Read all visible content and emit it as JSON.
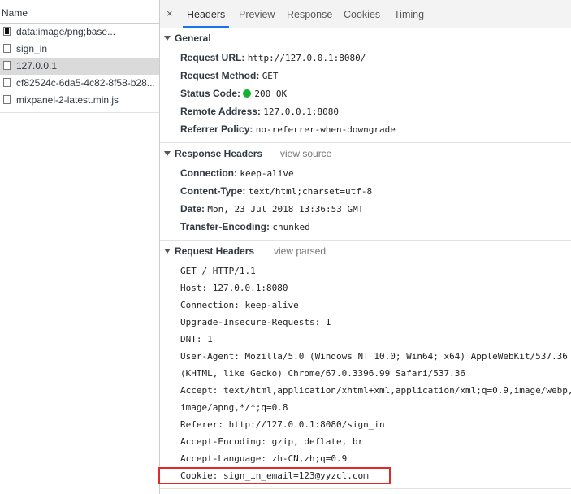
{
  "left_panel": {
    "header": "Name",
    "files": [
      {
        "name": "data:image/png;base...",
        "icon": "image-file-icon"
      },
      {
        "name": "sign_in",
        "icon": "document-icon"
      },
      {
        "name": "127.0.0.1",
        "icon": "document-icon",
        "selected": true
      },
      {
        "name": "cf82524c-6da5-4c82-8f58-b28...",
        "icon": "document-icon"
      },
      {
        "name": "mixpanel-2-latest.min.js",
        "icon": "document-icon"
      }
    ]
  },
  "tabs": {
    "close": "×",
    "items": [
      "Headers",
      "Preview",
      "Response",
      "Cookies",
      "Timing"
    ],
    "active": "Headers"
  },
  "general": {
    "title": "General",
    "request_url_label": "Request URL:",
    "request_url": "http://127.0.0.1:8080/",
    "request_method_label": "Request Method:",
    "request_method": "GET",
    "status_code_label": "Status Code:",
    "status_code": "200 OK",
    "status_color": "#13b12f",
    "remote_address_label": "Remote Address:",
    "remote_address": "127.0.0.1:8080",
    "referrer_policy_label": "Referrer Policy:",
    "referrer_policy": "no-referrer-when-downgrade"
  },
  "response_headers": {
    "title": "Response Headers",
    "link": "view source",
    "items": [
      {
        "k": "Connection:",
        "v": "keep-alive"
      },
      {
        "k": "Content-Type:",
        "v": "text/html;charset=utf-8"
      },
      {
        "k": "Date:",
        "v": "Mon, 23 Jul 2018 13:36:53 GMT"
      },
      {
        "k": "Transfer-Encoding:",
        "v": "chunked"
      }
    ]
  },
  "request_headers": {
    "title": "Request Headers",
    "link": "view parsed",
    "lines": [
      "GET / HTTP/1.1",
      "Host: 127.0.0.1:8080",
      "Connection: keep-alive",
      "Upgrade-Insecure-Requests: 1",
      "DNT: 1",
      "User-Agent: Mozilla/5.0 (Windows NT 10.0; Win64; x64) AppleWebKit/537.36",
      "(KHTML, like Gecko) Chrome/67.0.3396.99 Safari/537.36",
      "Accept: text/html,application/xhtml+xml,application/xml;q=0.9,image/webp,",
      "image/apng,*/*;q=0.8",
      "Referer: http://127.0.0.1:8080/sign_in",
      "Accept-Encoding: gzip, deflate, br",
      "Accept-Language: zh-CN,zh;q=0.9",
      "Cookie: sign_in_email=123@yyzcl.com"
    ]
  },
  "highlight_color": "#e02a2a"
}
